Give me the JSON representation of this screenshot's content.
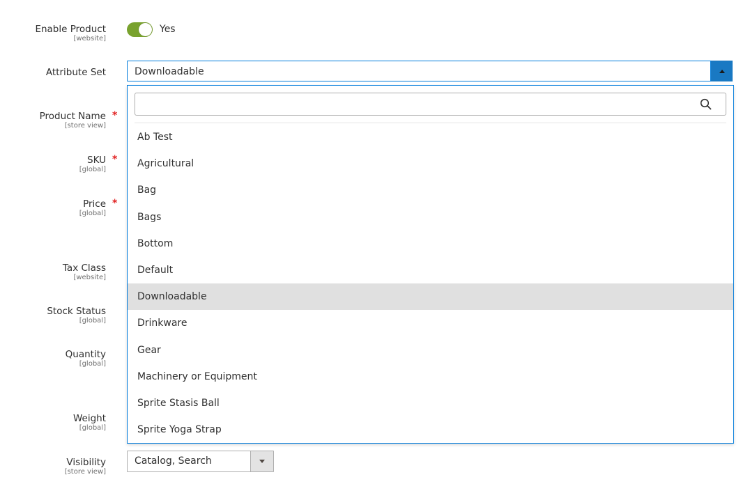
{
  "fields": {
    "enable_product": {
      "label": "Enable Product",
      "scope": "[website]",
      "value": "Yes",
      "checked": true
    },
    "attribute_set": {
      "label": "Attribute Set",
      "value": "Downloadable"
    },
    "product_name": {
      "label": "Product Name",
      "scope": "[store view]",
      "required": "*"
    },
    "sku": {
      "label": "SKU",
      "scope": "[global]",
      "required": "*"
    },
    "price": {
      "label": "Price",
      "scope": "[global]",
      "required": "*"
    },
    "tax_class": {
      "label": "Tax Class",
      "scope": "[website]"
    },
    "stock_status": {
      "label": "Stock Status",
      "scope": "[global]"
    },
    "quantity": {
      "label": "Quantity",
      "scope": "[global]"
    },
    "weight": {
      "label": "Weight",
      "scope": "[global]"
    },
    "visibility": {
      "label": "Visibility",
      "scope": "[store view]",
      "value": "Catalog, Search"
    }
  },
  "dropdown": {
    "search_placeholder": "",
    "search_icon": "search-icon",
    "selected": "Downloadable",
    "options": [
      "Ab Test",
      "Agricultural",
      "Bag",
      "Bags",
      "Bottom",
      "Default",
      "Downloadable",
      "Drinkware",
      "Gear",
      "Machinery or Equipment",
      "Sprite Stasis Ball",
      "Sprite Yoga Strap"
    ]
  },
  "colors": {
    "toggle_on": "#79a22e",
    "focus_border": "#007bdb",
    "caret_button": "#1979c3",
    "selected_option_bg": "#e0e0e0",
    "required": "#e22626"
  }
}
